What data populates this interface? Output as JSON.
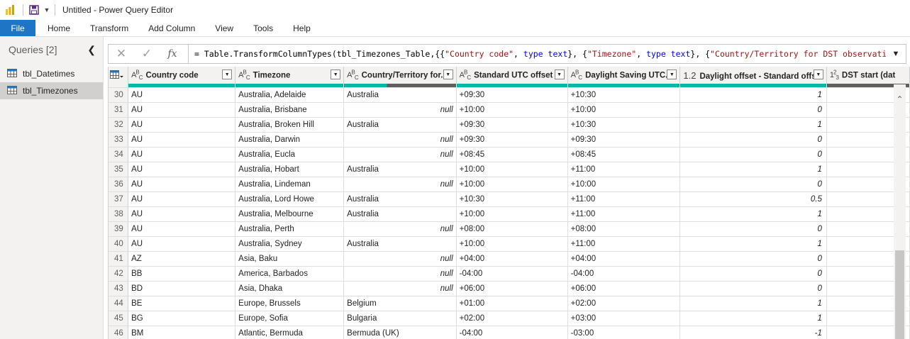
{
  "window": {
    "title": "Untitled - Power Query Editor"
  },
  "ribbon": {
    "tabs": [
      "File",
      "Home",
      "Transform",
      "Add Column",
      "View",
      "Tools",
      "Help"
    ]
  },
  "queries": {
    "header": "Queries [2]",
    "items": [
      {
        "label": "tbl_Datetimes"
      },
      {
        "label": "tbl_Timezones"
      }
    ]
  },
  "formula_bar": {
    "parts": [
      {
        "t": "= Table.TransformColumnTypes(tbl_Timezones_Table,{{",
        "c": ""
      },
      {
        "t": "\"Country code\"",
        "c": "s"
      },
      {
        "t": ", ",
        "c": ""
      },
      {
        "t": "type",
        "c": "k"
      },
      {
        "t": " ",
        "c": ""
      },
      {
        "t": "text",
        "c": "k"
      },
      {
        "t": "}, {",
        "c": ""
      },
      {
        "t": "\"Timezone\"",
        "c": "s"
      },
      {
        "t": ", ",
        "c": ""
      },
      {
        "t": "type",
        "c": "k"
      },
      {
        "t": " ",
        "c": ""
      },
      {
        "t": "text",
        "c": "k"
      },
      {
        "t": "}, {",
        "c": ""
      },
      {
        "t": "\"Country/Territory for DST observation\"",
        "c": "s"
      },
      {
        "t": ",",
        "c": ""
      }
    ]
  },
  "grid": {
    "columns": [
      {
        "type": "ABC",
        "label": "Country code",
        "quality": "#01b8aa"
      },
      {
        "type": "ABC",
        "label": "Timezone",
        "quality": "#01b8aa"
      },
      {
        "type": "ABC",
        "label": "Country/Territory for...",
        "quality": "split"
      },
      {
        "type": "ABC",
        "label": "Standard UTC offset",
        "quality": "#01b8aa"
      },
      {
        "type": "ABC",
        "label": "Daylight Saving UTC...",
        "quality": "#01b8aa"
      },
      {
        "type": "1.2",
        "label": "Daylight offset - Standard offset",
        "quality": "#01b8aa"
      },
      {
        "type": "123",
        "label": "DST start (dat",
        "quality": "#605e5c"
      }
    ],
    "rows": [
      [
        "30",
        "AU",
        "Australia, Adelaide",
        "Australia",
        "+09:30",
        "+10:30",
        "1"
      ],
      [
        "31",
        "AU",
        "Australia, Brisbane",
        "null",
        "+10:00",
        "+10:00",
        "0"
      ],
      [
        "32",
        "AU",
        "Australia, Broken Hill",
        "Australia",
        "+09:30",
        "+10:30",
        "1"
      ],
      [
        "33",
        "AU",
        "Australia, Darwin",
        "null",
        "+09:30",
        "+09:30",
        "0"
      ],
      [
        "34",
        "AU",
        "Australia, Eucla",
        "null",
        "+08:45",
        "+08:45",
        "0"
      ],
      [
        "35",
        "AU",
        "Australia, Hobart",
        "Australia",
        "+10:00",
        "+11:00",
        "1"
      ],
      [
        "36",
        "AU",
        "Australia, Lindeman",
        "null",
        "+10:00",
        "+10:00",
        "0"
      ],
      [
        "37",
        "AU",
        "Australia, Lord Howe",
        "Australia",
        "+10:30",
        "+11:00",
        "0.5"
      ],
      [
        "38",
        "AU",
        "Australia, Melbourne",
        "Australia",
        "+10:00",
        "+11:00",
        "1"
      ],
      [
        "39",
        "AU",
        "Australia, Perth",
        "null",
        "+08:00",
        "+08:00",
        "0"
      ],
      [
        "40",
        "AU",
        "Australia, Sydney",
        "Australia",
        "+10:00",
        "+11:00",
        "1"
      ],
      [
        "41",
        "AZ",
        "Asia, Baku",
        "null",
        "+04:00",
        "+04:00",
        "0"
      ],
      [
        "42",
        "BB",
        "America, Barbados",
        "null",
        "-04:00",
        "-04:00",
        "0"
      ],
      [
        "43",
        "BD",
        "Asia, Dhaka",
        "null",
        "+06:00",
        "+06:00",
        "0"
      ],
      [
        "44",
        "BE",
        "Europe, Brussels",
        "Belgium",
        "+01:00",
        "+02:00",
        "1"
      ],
      [
        "45",
        "BG",
        "Europe, Sofia",
        "Bulgaria",
        "+02:00",
        "+03:00",
        "1"
      ],
      [
        "46",
        "BM",
        "Atlantic, Bermuda",
        "Bermuda (UK)",
        "-04:00",
        "-03:00",
        "-1"
      ]
    ]
  },
  "colors": {
    "file_tab": "#1e75c5",
    "quality_valid": "#01b8aa",
    "quality_empty": "#605e5c"
  }
}
